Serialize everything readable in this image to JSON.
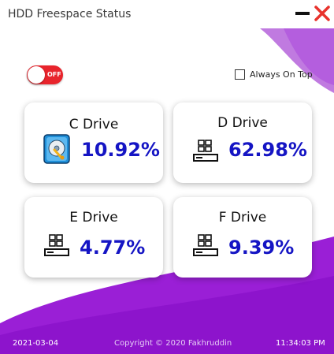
{
  "window": {
    "title": "HDD Freespace Status",
    "minimize_icon": "minimize-icon",
    "close_icon": "close-icon"
  },
  "toggle": {
    "state_label": "OFF",
    "on": false
  },
  "always_on_top": {
    "label": "Always On Top",
    "checked": false
  },
  "drives": [
    {
      "title": "C Drive",
      "value": "10.92%",
      "icon": "hard-disk-icon"
    },
    {
      "title": "D Drive",
      "value": "62.98%",
      "icon": "windows-drive-icon"
    },
    {
      "title": "E Drive",
      "value": "4.77%",
      "icon": "windows-drive-icon"
    },
    {
      "title": "F Drive",
      "value": "9.39%",
      "icon": "windows-drive-icon"
    }
  ],
  "footer": {
    "date": "2021-03-04",
    "copyright": "Copyright © 2020 Fakhruddin",
    "time": "11:34:03 PM"
  },
  "colors": {
    "accent_purple": "#9a1fd6",
    "light_purple": "#c07ae0",
    "value_blue": "#1515c4",
    "close_red": "#e8322c",
    "toggle_red": "#e8242c"
  }
}
